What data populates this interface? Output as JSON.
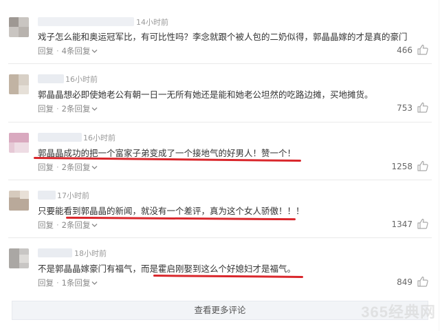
{
  "comments": [
    {
      "time": "14小时前",
      "text": "戏子怎么能和奥运冠军比，有可比性吗？李念就跟个被人包的二奶似得，郭晶晶嫁的才是真的豪门",
      "reply_label": "回复",
      "replies_label": "4条回复",
      "likes": "466"
    },
    {
      "time": "16小时前",
      "text": "郭晶晶想必即使她老公有朝一日一无所有她还是能和她老公坦然的吃路边摊，买地摊货。",
      "reply_label": "回复",
      "replies_label": "2条回复",
      "likes": "753"
    },
    {
      "time": "16小时前",
      "text": "郭晶晶成功的把一个富家子弟变成了一个接地气的好男人！赞一个！",
      "reply_label": "回复",
      "replies_label": "2条回复",
      "likes": "1258"
    },
    {
      "time": "17小时前",
      "text": "只要能看到郭晶晶的新闻，就没有一个差评，真为这个女人骄傲！！！",
      "reply_label": "回复",
      "replies_label": "2条回复",
      "likes": "1347"
    },
    {
      "time": "18小时前",
      "text": "不是郭晶晶嫁豪门有福气，而是霍启刚娶到这么个好媳妇才是福气。",
      "reply_label": "回复",
      "replies_label": "1条回复",
      "likes": "849"
    }
  ],
  "more_label": "查看更多评论",
  "watermark": "365经典网",
  "colors": {
    "underline": "#d9262b",
    "muted": "#999999",
    "text": "#333333",
    "more_bg": "#f2f4f7"
  }
}
